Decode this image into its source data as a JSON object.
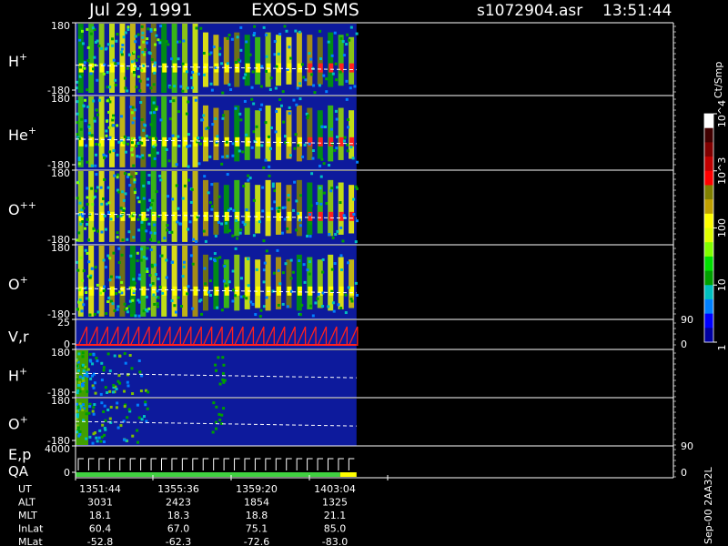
{
  "header": {
    "date": "Jul 29, 1991",
    "instrument": "EXOS-D SMS",
    "file": "s1072904.asr",
    "time": "13:51:44"
  },
  "colorbar": {
    "unit": "Ct/Smp",
    "tick_labels": [
      "1",
      "10",
      "100",
      "10^3",
      "10^4"
    ],
    "tick_values": [
      1,
      10,
      100,
      1000,
      10000
    ],
    "scale": "log",
    "colors": [
      "#0000a0",
      "#0000ff",
      "#0080ff",
      "#00c0c0",
      "#00a000",
      "#00e000",
      "#80ff00",
      "#e0ff00",
      "#ffff00",
      "#c0a000",
      "#808000",
      "#ff0000",
      "#c00000",
      "#800000",
      "#400000",
      "#ffffff"
    ]
  },
  "panels": [
    {
      "label": "H",
      "sup": "+",
      "ymax": "180",
      "ymin": "-180",
      "kind": "spectrogram",
      "end_color": "#ff2020"
    },
    {
      "label": "He",
      "sup": "+",
      "ymax": "180",
      "ymin": "-180",
      "kind": "spectrogram",
      "end_color": "#ff2020"
    },
    {
      "label": "O",
      "sup": "++",
      "ymax": "180",
      "ymin": "-180",
      "kind": "spectrogram",
      "end_color": "#ff2020"
    },
    {
      "label": "O",
      "sup": "+",
      "ymax": "180",
      "ymin": "-180",
      "kind": "spectrogram",
      "end_color": "#ffff00"
    },
    {
      "label": "V,r",
      "sup": "",
      "ymax": "25",
      "ymin": "0",
      "kind": "sawtooth",
      "right_top": "90",
      "right_bottom": "0"
    },
    {
      "label": "H",
      "sup": "+",
      "ymax": "180",
      "ymin": "-180",
      "kind": "sparse"
    },
    {
      "label": "O",
      "sup": "+",
      "ymax": "180",
      "ymin": "-180",
      "kind": "sparse"
    },
    {
      "label": "E,p",
      "sub_label": "QA",
      "sup": "",
      "ymax": "4000",
      "ymin": "0",
      "kind": "steps",
      "right_top": "90",
      "right_bottom": "0"
    }
  ],
  "footer": {
    "rows": [
      {
        "name": "UT",
        "values": [
          "1351:44",
          "1355:36",
          "1359:20",
          "1403:04"
        ]
      },
      {
        "name": "ALT",
        "values": [
          "3031",
          "2423",
          "1854",
          "1325"
        ]
      },
      {
        "name": "MLT",
        "values": [
          "18.1",
          "18.3",
          "18.8",
          "21.1"
        ]
      },
      {
        "name": "InLat",
        "values": [
          "60.4",
          "67.0",
          "75.1",
          "85.0"
        ]
      },
      {
        "name": "MLat",
        "values": [
          "-52.8",
          "-62.3",
          "-72.6",
          "-83.0"
        ]
      }
    ],
    "stamp": "Sep-00 2AA32L"
  },
  "chart_data": {
    "type": "heatmap",
    "title": "Jul 29, 1991   EXOS-D SMS",
    "x_ticks_ut": [
      "1351:44",
      "1355:36",
      "1359:20",
      "1403:04"
    ],
    "y_range_pitch_angle": [
      -180,
      180
    ],
    "data_end_fraction_of_axis": 0.47,
    "spin_count_in_data": 27,
    "color_scale": {
      "unit": "Ct/Smp",
      "type": "log",
      "range": [
        1,
        10000
      ]
    }
  }
}
